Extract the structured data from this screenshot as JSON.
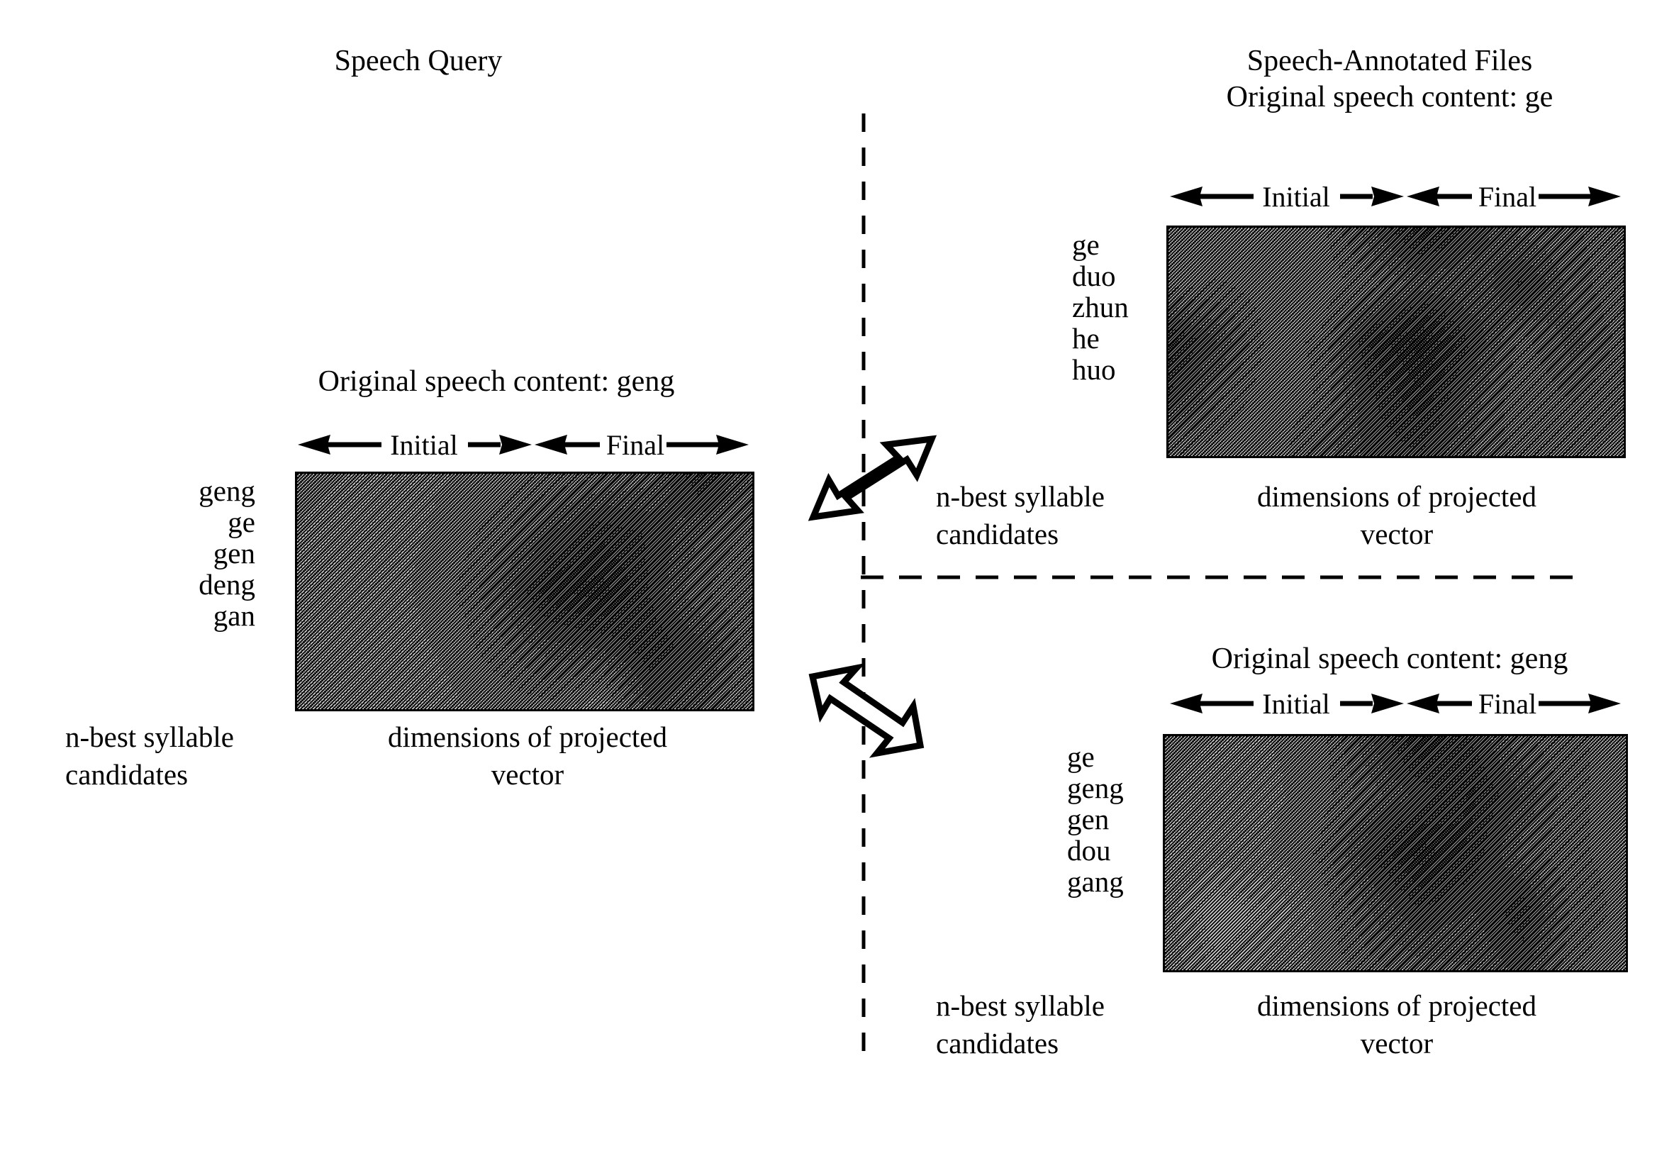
{
  "figure": {
    "left_header": "Speech Query",
    "right_header": "Speech-Annotated Files"
  },
  "axis": {
    "initial_label": "Initial",
    "final_label": "Final"
  },
  "captions": {
    "candidates_line1": "n-best syllable",
    "candidates_line2": "candidates",
    "dimensions_line1": "dimensions of projected",
    "dimensions_line2": "vector"
  },
  "panels": {
    "query": {
      "title": "Original speech content: geng",
      "candidates": [
        "geng",
        "ge",
        "gen",
        "deng",
        "gan"
      ],
      "caption_left_line1": "n-best syllable",
      "caption_left_line2": "candidates",
      "caption_right_line1": "dimensions of projected",
      "caption_right_line2": "vector"
    },
    "file_top": {
      "title": "Original speech content: ge",
      "candidates": [
        "ge",
        "duo",
        "zhun",
        "he",
        "huo"
      ],
      "caption_left_line1": "n-best syllable",
      "caption_left_line2": "candidates",
      "caption_right_line1": "dimensions of projected",
      "caption_right_line2": "vector"
    },
    "file_bottom": {
      "title": "Original speech content: geng",
      "candidates": [
        "ge",
        "geng",
        "gen",
        "dou",
        "gang"
      ],
      "caption_left_line1": "n-best syllable",
      "caption_left_line2": "candidates",
      "caption_right_line1": "dimensions of projected",
      "caption_right_line2": "vector"
    }
  },
  "colors": {
    "ink": "#000000",
    "paper": "#ffffff"
  },
  "chart_data": [
    {
      "type": "heatmap",
      "name": "query-heatmap",
      "title": "Original speech content: geng",
      "ylabel": "n-best syllable candidates",
      "xlabel": "dimensions of projected vector",
      "ytick_labels": [
        "geng",
        "ge",
        "gen",
        "deng",
        "gan"
      ],
      "x_segments": [
        "Initial",
        "Final"
      ],
      "grid": false,
      "rows": 5,
      "cols": 10,
      "values": [
        [
          0.46,
          0.45,
          0.44,
          0.45,
          0.47,
          0.5,
          0.53,
          0.56,
          0.72,
          0.58
        ],
        [
          0.45,
          0.44,
          0.44,
          0.46,
          0.52,
          0.62,
          0.7,
          0.66,
          0.58,
          0.52
        ],
        [
          0.44,
          0.43,
          0.44,
          0.48,
          0.58,
          0.74,
          0.78,
          0.66,
          0.54,
          0.5
        ],
        [
          0.44,
          0.43,
          0.43,
          0.46,
          0.52,
          0.6,
          0.62,
          0.7,
          0.64,
          0.5
        ],
        [
          0.44,
          0.43,
          0.43,
          0.44,
          0.46,
          0.48,
          0.4,
          0.62,
          0.58,
          0.48
        ]
      ]
    },
    {
      "type": "heatmap",
      "name": "file-top-heatmap",
      "title": "Original speech content: ge",
      "ylabel": "n-best syllable candidates",
      "xlabel": "dimensions of projected vector",
      "ytick_labels": [
        "ge",
        "duo",
        "zhun",
        "he",
        "huo"
      ],
      "x_segments": [
        "Initial",
        "Final"
      ],
      "grid": false,
      "rows": 5,
      "cols": 10,
      "values": [
        [
          0.46,
          0.45,
          0.45,
          0.48,
          0.62,
          0.74,
          0.66,
          0.56,
          0.54,
          0.52
        ],
        [
          0.48,
          0.5,
          0.47,
          0.46,
          0.52,
          0.6,
          0.58,
          0.68,
          0.56,
          0.5
        ],
        [
          0.74,
          0.62,
          0.48,
          0.5,
          0.72,
          0.82,
          0.66,
          0.52,
          0.6,
          0.52
        ],
        [
          0.66,
          0.54,
          0.46,
          0.5,
          0.66,
          0.74,
          0.6,
          0.5,
          0.54,
          0.5
        ],
        [
          0.5,
          0.46,
          0.46,
          0.56,
          0.64,
          0.66,
          0.58,
          0.52,
          0.5,
          0.48
        ]
      ]
    },
    {
      "type": "heatmap",
      "name": "file-bottom-heatmap",
      "title": "Original speech content: geng",
      "ylabel": "n-best syllable candidates",
      "xlabel": "dimensions of projected vector",
      "ytick_labels": [
        "ge",
        "geng",
        "gen",
        "dou",
        "gang"
      ],
      "x_segments": [
        "Initial",
        "Final"
      ],
      "grid": false,
      "rows": 5,
      "cols": 10,
      "values": [
        [
          0.46,
          0.45,
          0.45,
          0.47,
          0.62,
          0.76,
          0.66,
          0.54,
          0.5,
          0.48
        ],
        [
          0.45,
          0.44,
          0.44,
          0.47,
          0.56,
          0.64,
          0.72,
          0.62,
          0.5,
          0.48
        ],
        [
          0.44,
          0.44,
          0.45,
          0.5,
          0.66,
          0.78,
          0.7,
          0.56,
          0.5,
          0.48
        ],
        [
          0.44,
          0.3,
          0.36,
          0.46,
          0.58,
          0.66,
          0.62,
          0.7,
          0.52,
          0.48
        ],
        [
          0.44,
          0.36,
          0.42,
          0.46,
          0.52,
          0.56,
          0.58,
          0.64,
          0.5,
          0.46
        ]
      ]
    }
  ]
}
